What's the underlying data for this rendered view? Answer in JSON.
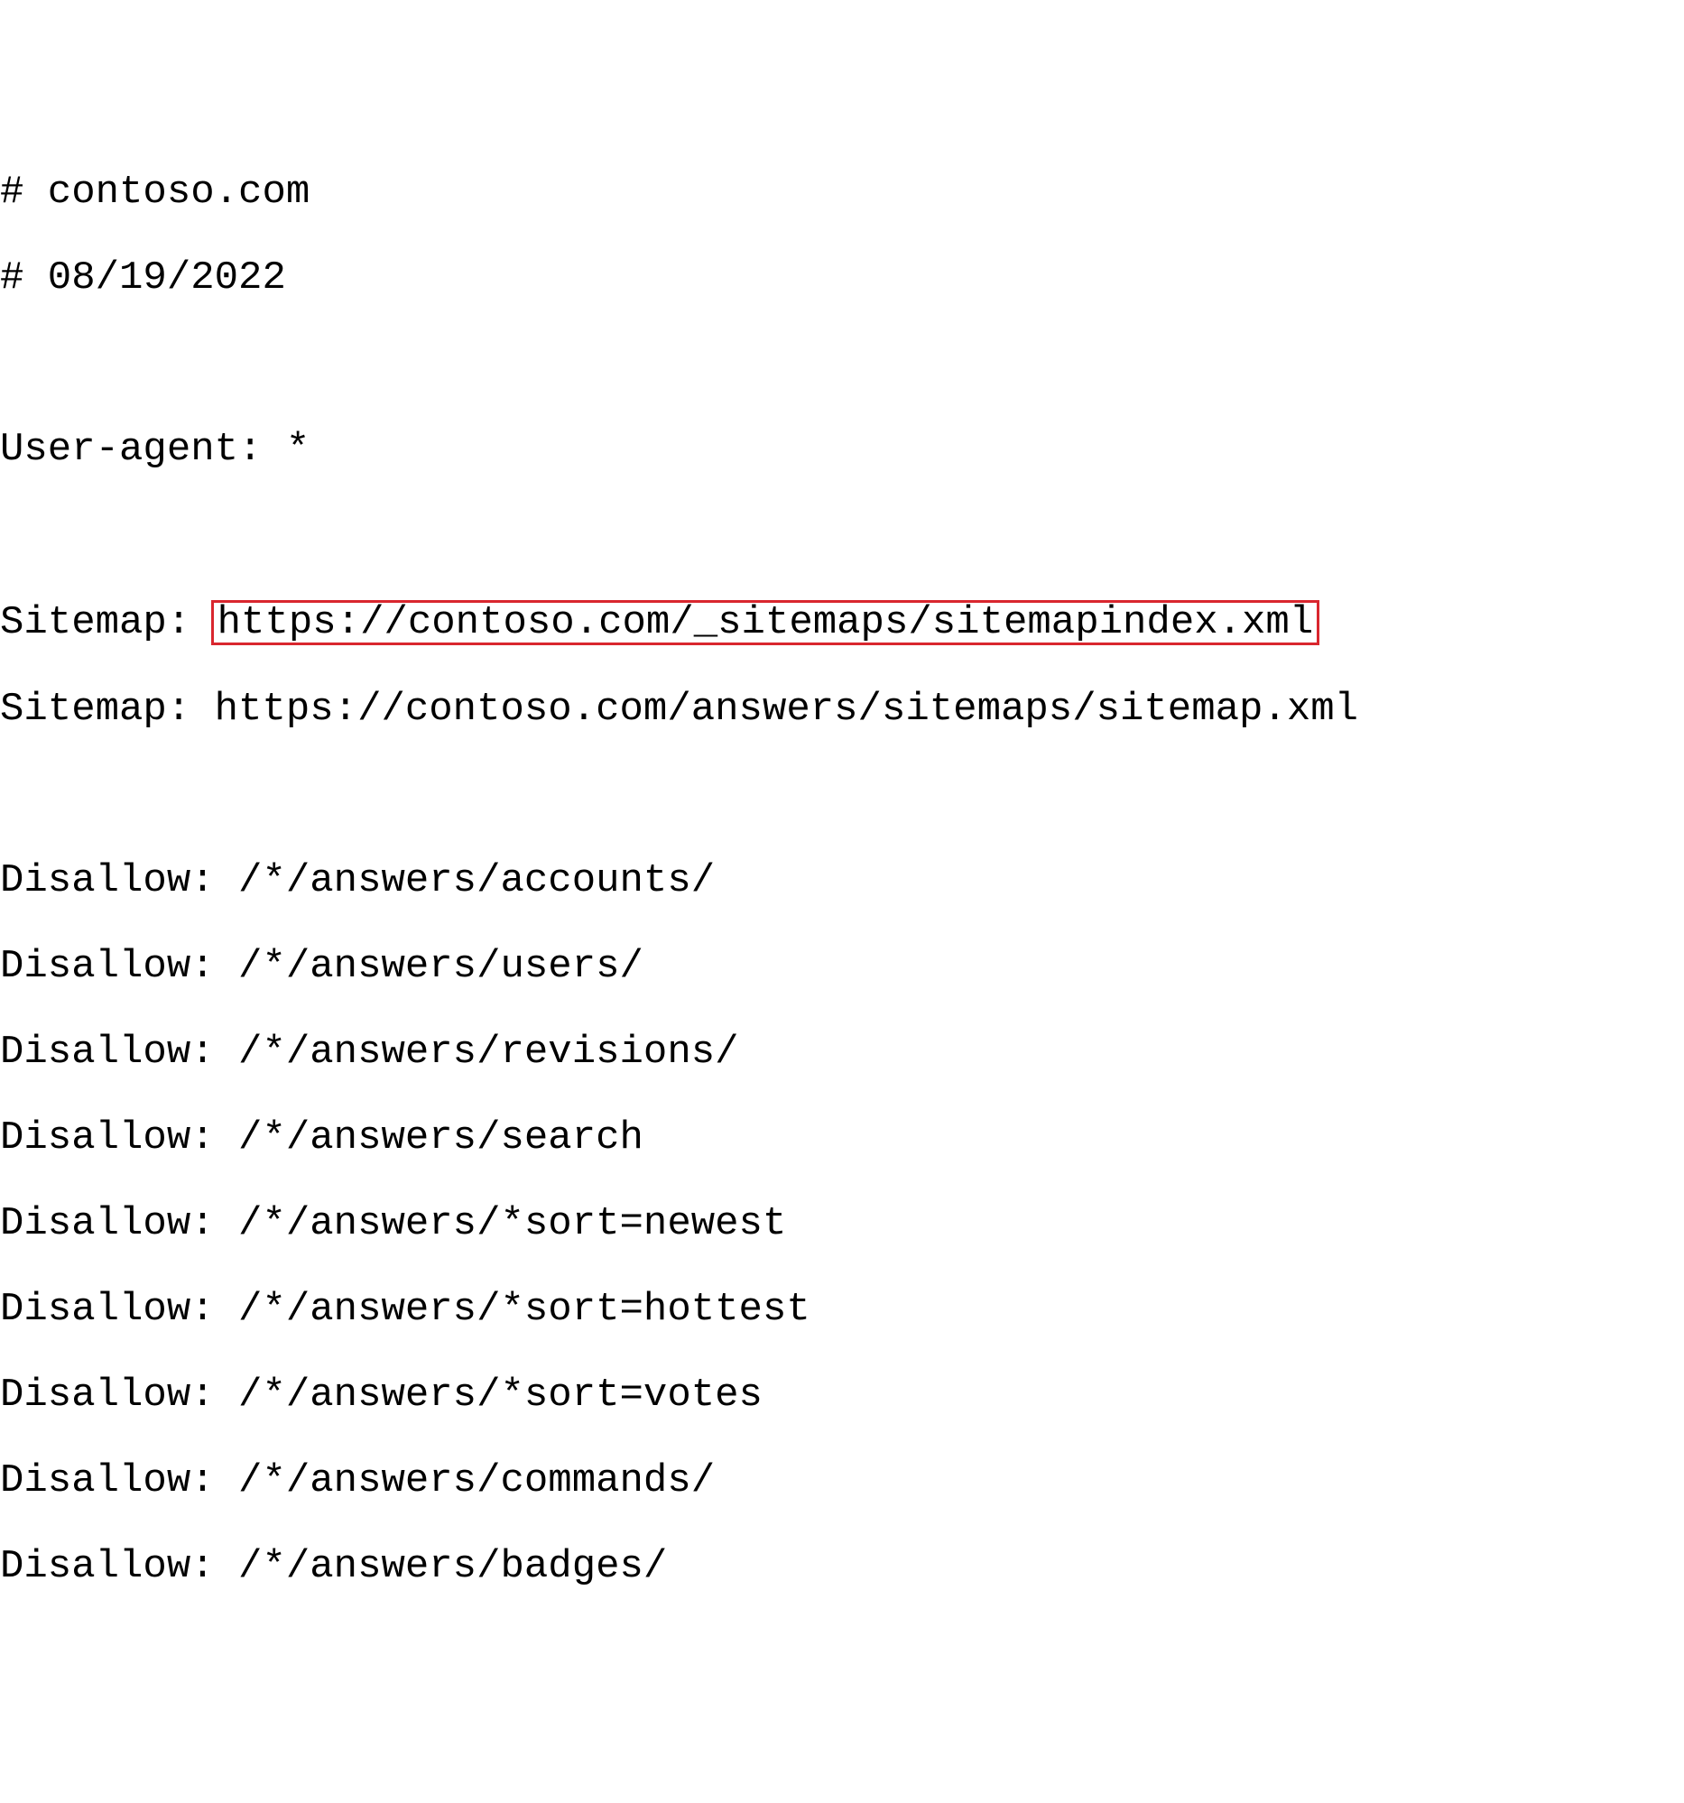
{
  "lines": {
    "comment_domain": "# contoso.com",
    "comment_date": "# 08/19/2022",
    "user_agent": "User-agent: *",
    "sitemap1_label": "Sitemap: ",
    "sitemap1_value": "https://contoso.com/_sitemaps/sitemapindex.xml",
    "sitemap2": "Sitemap: https://contoso.com/answers/sitemaps/sitemap.xml",
    "disallow1": "Disallow: /*/answers/accounts/",
    "disallow2": "Disallow: /*/answers/users/",
    "disallow3": "Disallow: /*/answers/revisions/",
    "disallow4": "Disallow: /*/answers/search",
    "disallow5": "Disallow: /*/answers/*sort=newest",
    "disallow6": "Disallow: /*/answers/*sort=hottest",
    "disallow7": "Disallow: /*/answers/*sort=votes",
    "disallow8": "Disallow: /*/answers/commands/",
    "disallow9": "Disallow: /*/answers/badges/"
  },
  "highlight_color": "#d9262e"
}
